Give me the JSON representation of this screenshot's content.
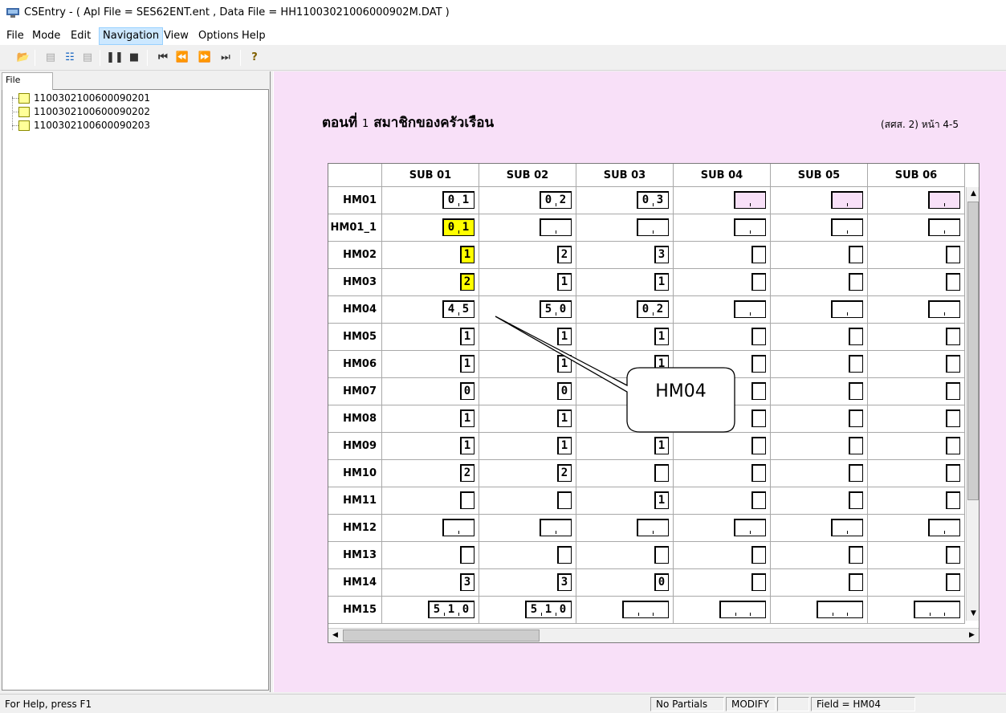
{
  "window": {
    "title": "CSEntry - ( Apl File = SES62ENT.ent , Data File = HH11003021006000902M.DAT )"
  },
  "menu": {
    "items": [
      "File",
      "Mode",
      "Edit",
      "Navigation",
      "View",
      "Options",
      "Help"
    ],
    "active": "Navigation"
  },
  "toolbar": {
    "icons": [
      "open-icon",
      "add-case-icon",
      "insert-case-icon",
      "verify-icon",
      "pause-icon",
      "stop-icon",
      "first-icon",
      "previous-icon",
      "next-icon",
      "last-icon",
      "help-icon"
    ]
  },
  "sidebar": {
    "tab_label": "File",
    "cases": [
      "1100302100600090201",
      "1100302100600090202",
      "1100302100600090203"
    ]
  },
  "form": {
    "title_part1": "ตอนที่",
    "title_num": "1",
    "title_part2": "สมาชิกของครัวเรือน",
    "reference": "(สศส. 2) หน้า 4-5",
    "background": "#f8e0f8",
    "columns": [
      "SUB 01",
      "SUB 02",
      "SUB 03",
      "SUB 04",
      "SUB 05",
      "SUB 06"
    ],
    "rows": [
      {
        "label": "HM01",
        "width": 2,
        "values": [
          "01",
          "02",
          "03",
          "",
          "",
          ""
        ],
        "styles": [
          "",
          "",
          "",
          "pink",
          "pink",
          "pink"
        ]
      },
      {
        "label": "HM01_1",
        "width": 2,
        "values": [
          "01",
          "",
          "",
          "",
          "",
          ""
        ],
        "styles": [
          "yellow",
          "",
          "",
          "",
          "",
          ""
        ]
      },
      {
        "label": "HM02",
        "width": 1,
        "values": [
          "1",
          "2",
          "3",
          "",
          "",
          ""
        ],
        "styles": [
          "yellow",
          "",
          "",
          "",
          "",
          ""
        ]
      },
      {
        "label": "HM03",
        "width": 1,
        "values": [
          "2",
          "1",
          "1",
          "",
          "",
          ""
        ],
        "styles": [
          "yellow",
          "",
          "",
          "",
          "",
          ""
        ]
      },
      {
        "label": "HM04",
        "width": 2,
        "values": [
          "45",
          "50",
          "02",
          "",
          "",
          ""
        ],
        "styles": [
          "",
          "",
          "",
          "",
          "",
          ""
        ]
      },
      {
        "label": "HM05",
        "width": 1,
        "values": [
          "1",
          "1",
          "1",
          "",
          "",
          ""
        ],
        "styles": [
          "",
          "",
          "",
          "",
          "",
          ""
        ]
      },
      {
        "label": "HM06",
        "width": 1,
        "values": [
          "1",
          "1",
          "1",
          "",
          "",
          ""
        ],
        "styles": [
          "",
          "",
          "",
          "",
          "",
          ""
        ]
      },
      {
        "label": "HM07",
        "width": 1,
        "values": [
          "0",
          "0",
          "",
          "",
          "",
          ""
        ],
        "styles": [
          "",
          "",
          "",
          "",
          "",
          ""
        ]
      },
      {
        "label": "HM08",
        "width": 1,
        "values": [
          "1",
          "1",
          "",
          "",
          "",
          ""
        ],
        "styles": [
          "",
          "",
          "",
          "",
          "",
          ""
        ]
      },
      {
        "label": "HM09",
        "width": 1,
        "values": [
          "1",
          "1",
          "1",
          "",
          "",
          ""
        ],
        "styles": [
          "",
          "",
          "",
          "",
          "",
          ""
        ]
      },
      {
        "label": "HM10",
        "width": 1,
        "values": [
          "2",
          "2",
          "",
          "",
          "",
          ""
        ],
        "styles": [
          "",
          "",
          "",
          "",
          "",
          ""
        ]
      },
      {
        "label": "HM11",
        "width": 1,
        "values": [
          "",
          "",
          "1",
          "",
          "",
          ""
        ],
        "styles": [
          "",
          "",
          "",
          "",
          "",
          ""
        ]
      },
      {
        "label": "HM12",
        "width": 2,
        "values": [
          "",
          "",
          "",
          "",
          "",
          ""
        ],
        "styles": [
          "",
          "",
          "",
          "",
          "",
          ""
        ]
      },
      {
        "label": "HM13",
        "width": 1,
        "values": [
          "",
          "",
          "",
          "",
          "",
          ""
        ],
        "styles": [
          "",
          "",
          "",
          "",
          "",
          ""
        ]
      },
      {
        "label": "HM14",
        "width": 1,
        "values": [
          "3",
          "3",
          "0",
          "",
          "",
          ""
        ],
        "styles": [
          "",
          "",
          "",
          "",
          "",
          ""
        ]
      },
      {
        "label": "HM15",
        "width": 3,
        "values": [
          "510",
          "510",
          "",
          "",
          "",
          ""
        ],
        "styles": [
          "",
          "",
          "",
          "",
          "",
          ""
        ]
      }
    ],
    "callout_text": "HM04"
  },
  "colors": {
    "highlight": "#ffff00",
    "form_background": "#f8e0f8",
    "menu_active": "#cce8ff"
  },
  "status": {
    "help": "For Help, press F1",
    "partials": "No Partials",
    "mode": "MODIFY",
    "blank": "",
    "field": "Field = HM04"
  }
}
